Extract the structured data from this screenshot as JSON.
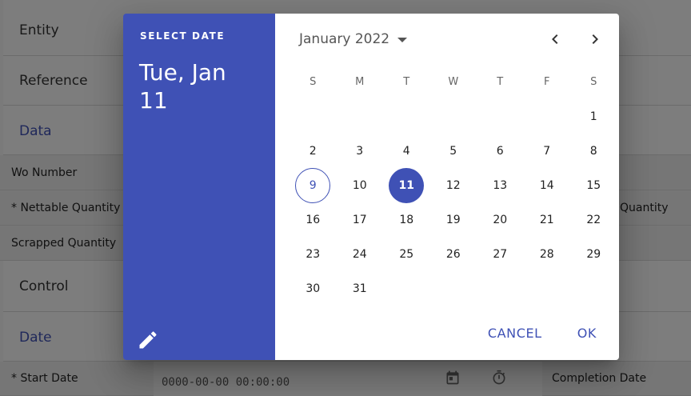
{
  "background": {
    "sections": {
      "entity": "Entity",
      "reference": "Reference",
      "data": "Data",
      "control": "Control",
      "date": "Date"
    },
    "fields": {
      "wo_number": "Wo Number",
      "nettable_quantity": "* Nettable Quantity",
      "nettable_quantity_right": "Quantity",
      "scrapped_quantity": "Scrapped Quantity",
      "start_date": "* Start Date",
      "start_date_value": "0000-00-00 00:00:00",
      "completion_date": "Completion Date"
    }
  },
  "datepicker": {
    "overline": "SELECT DATE",
    "selected_title": "Tue, Jan 11",
    "month_label": "January 2022",
    "weekdays": [
      "S",
      "M",
      "T",
      "W",
      "T",
      "F",
      "S"
    ],
    "today": 9,
    "selected": 11,
    "weeks": [
      [
        null,
        null,
        null,
        null,
        null,
        null,
        1
      ],
      [
        2,
        3,
        4,
        5,
        6,
        7,
        8
      ],
      [
        9,
        10,
        11,
        12,
        13,
        14,
        15
      ],
      [
        16,
        17,
        18,
        19,
        20,
        21,
        22
      ],
      [
        23,
        24,
        25,
        26,
        27,
        28,
        29
      ],
      [
        30,
        31,
        null,
        null,
        null,
        null,
        null
      ]
    ],
    "cancel_label": "CANCEL",
    "ok_label": "OK",
    "icons": {
      "edit": "pencil-icon",
      "prev": "chevron-left-icon",
      "next": "chevron-right-icon",
      "calendar": "calendar-icon",
      "timer": "timer-icon"
    },
    "colors": {
      "primary": "#3f51b5"
    }
  }
}
